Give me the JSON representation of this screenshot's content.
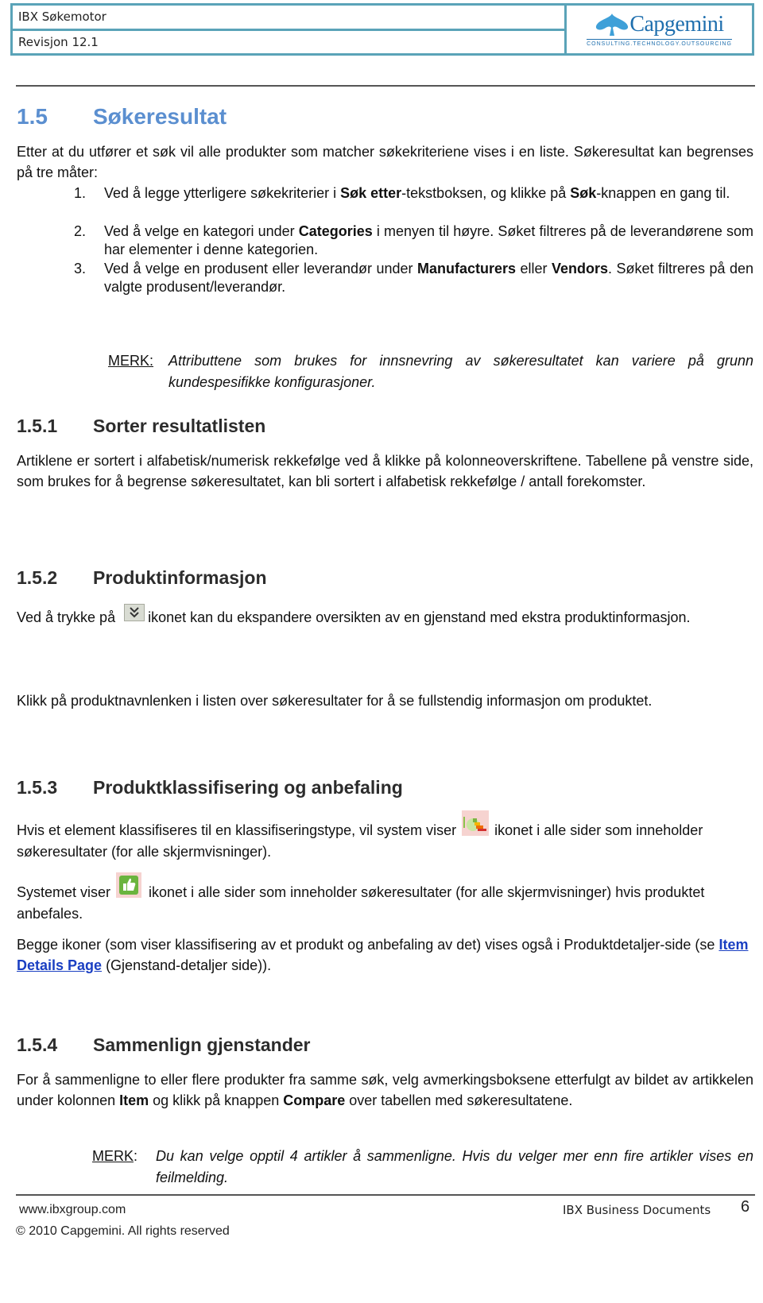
{
  "header": {
    "title": "IBX Søkemotor",
    "revision": "Revisjon 12.1",
    "logo_name": "Capgemini",
    "logo_tagline": "CONSULTING.TECHNOLOGY.OUTSOURCING",
    "border_color": "#5aa3b8"
  },
  "section": {
    "number": "1.5",
    "title": "Søkeresultat",
    "intro": "Etter at du utfører et søk vil alle produkter som matcher søkekriteriene vises i en liste. Søkeresultat kan begrenses på tre måter:",
    "list": [
      {
        "n": "1.",
        "a": "Ved å legge ytterligere søkekriterier i ",
        "b1": "Søk etter",
        "c": "-tekstboksen, og klikke på ",
        "b2": "Søk",
        "d": "-knappen en gang til."
      },
      {
        "n": "2.",
        "a": "Ved å velge en kategori under ",
        "b1": "Categories",
        "c": " i menyen til høyre. Søket filtreres på de leverandørene som har elementer i denne kategorien."
      },
      {
        "n": "3.",
        "a": "Ved å velge en produsent eller leverandør under ",
        "b1": "Manufacturers",
        "c": " eller ",
        "b2": "Vendors",
        "d": ". Søket filtreres på den valgte produsent/leverandør."
      }
    ],
    "note_label": "MERK:",
    "note_text": "Attributtene som brukes for innsnevring av søkeresultatet kan variere på grunn kundespesifikke konfigurasjoner."
  },
  "sub1": {
    "number": "1.5.1",
    "title": "Sorter resultatlisten",
    "text": "Artiklene er sortert i alfabetisk/numerisk rekkefølge ved å klikke på kolonneoverskriftene. Tabellene på venstre side, som brukes for å begrense søkeresultatet, kan bli sortert i alfabetisk rekkefølge / antall forekomster."
  },
  "sub2": {
    "number": "1.5.2",
    "title": "Produktinformasjon",
    "text_before_icon": "Ved å trykke på ",
    "icon": "expand-icon",
    "text_after_icon": "ikonet kan du ekspandere oversikten av en gjenstand med ekstra produktinformasjon.",
    "text2": "Klikk på produktnavnlenken i listen over søkeresultater for å se fullstendig informasjon om produktet."
  },
  "sub3": {
    "number": "1.5.3",
    "title": "Produktklassifisering og anbefaling",
    "p1_before": "Hvis et element klassifiseres til en klassifiseringstype, vil system viser ",
    "p1_icon": "classification-icon",
    "p1_after": " ikonet i alle sider som inneholder søkeresultater (for alle skjermvisninger).",
    "p2_before": "Systemet viser ",
    "p2_icon": "thumbs-up-icon",
    "p2_after": " ikonet i alle sider som inneholder søkeresultater (for alle skjermvisninger) hvis produktet anbefales.",
    "p3_before": "Begge ikoner (som viser klassifisering av et produkt og anbefaling av det) vises også i Produktdetaljer-side (se ",
    "p3_link": "Item Details Page",
    "p3_after": " (Gjenstand-detaljer side))."
  },
  "sub4": {
    "number": "1.5.4",
    "title": "Sammenlign gjenstander",
    "t1": "For å sammenligne to eller flere produkter fra samme søk, velg avmerkingsboksene etterfulgt av bildet av artikkelen under kolonnen ",
    "b1": "Item",
    "t2": " og klikk på knappen ",
    "b2": "Compare",
    "t3": " over tabellen med søkeresultatene.",
    "note_label": "MERK",
    "note_colon": ":",
    "note_text": "Du kan velge opptil 4 artikler å sammenligne. Hvis du velger mer enn fire artikler vises en feilmelding."
  },
  "footer": {
    "website": "www.ibxgroup.com",
    "doc_name": "IBX Business Documents",
    "page_number": "6",
    "copyright": "© 2010 Capgemini. All rights reserved"
  }
}
